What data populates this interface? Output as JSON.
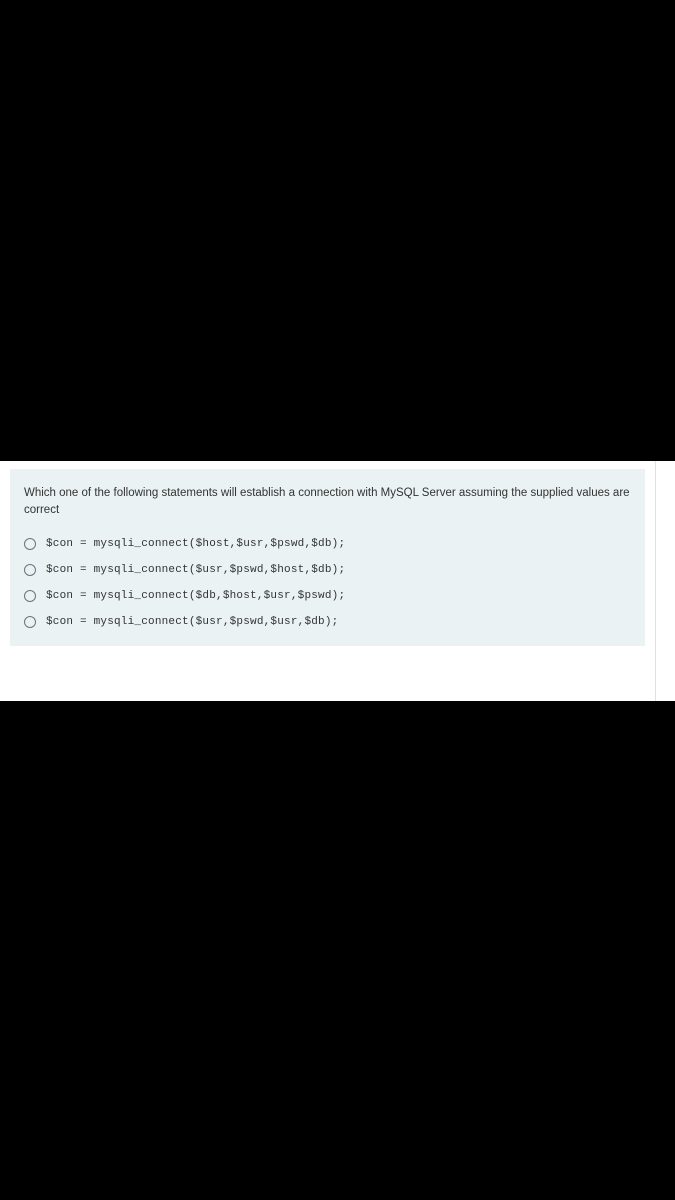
{
  "question": {
    "text": "Which one of the following statements will establish a connection with MySQL Server assuming the supplied values are correct",
    "options": [
      {
        "code": "$con = mysqli_connect($host,$usr,$pswd,$db);"
      },
      {
        "code": "$con = mysqli_connect($usr,$pswd,$host,$db);"
      },
      {
        "code": "$con = mysqli_connect($db,$host,$usr,$pswd);"
      },
      {
        "code": "$con = mysqli_connect($usr,$pswd,$usr,$db);"
      }
    ]
  }
}
